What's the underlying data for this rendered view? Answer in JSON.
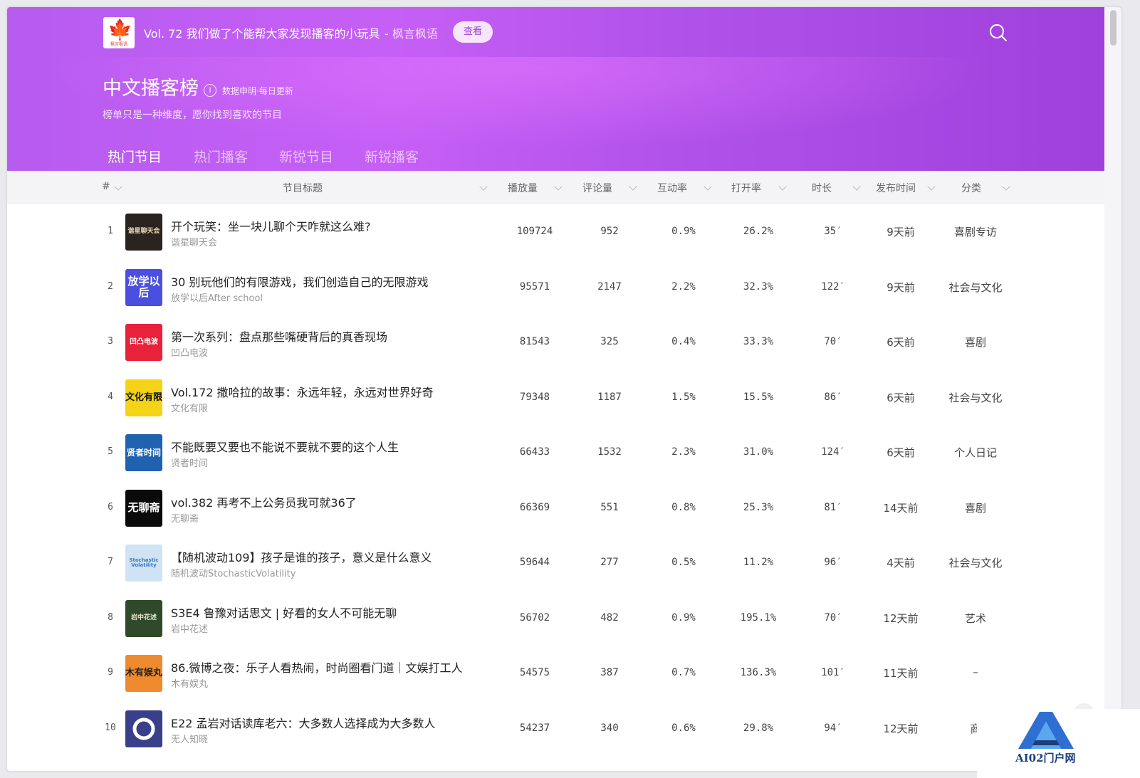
{
  "topbar": {
    "logo_text": "枫言枫语",
    "episode_title": "Vol. 72 我们做了个能帮大家发现播客的小玩具",
    "podcast_name": "- 枫言枫语",
    "view_button": "查看"
  },
  "header": {
    "title": "中文播客榜",
    "info_text": "数据申明·每日更新",
    "subtitle": "榜单只是一种维度，愿你找到喜欢的节目"
  },
  "tabs": [
    {
      "label": "热门节目",
      "active": true
    },
    {
      "label": "热门播客",
      "active": false
    },
    {
      "label": "新锐节目",
      "active": false
    },
    {
      "label": "新锐播客",
      "active": false
    }
  ],
  "columns": {
    "rank": "#",
    "title": "节目标题",
    "plays": "播放量",
    "comments": "评论量",
    "engagement": "互动率",
    "open_rate": "打开率",
    "duration": "时长",
    "published": "发布时间",
    "category": "分类"
  },
  "rows": [
    {
      "rank": "1",
      "title": "开个玩笑：坐一块儿聊个天咋就这么难?",
      "show": "谐星聊天会",
      "plays": "109724",
      "comments": "952",
      "engagement": "0.9%",
      "open_rate": "26.2%",
      "duration": "35′",
      "published": "9天前",
      "category": "喜剧专访",
      "cover_text": "谐星聊天会"
    },
    {
      "rank": "2",
      "title": "30 别玩他们的有限游戏，我们创造自己的无限游戏",
      "show": "放学以后After school",
      "plays": "95571",
      "comments": "2147",
      "engagement": "2.2%",
      "open_rate": "32.3%",
      "duration": "122′",
      "published": "9天前",
      "category": "社会与文化",
      "cover_text": "放学以后"
    },
    {
      "rank": "3",
      "title": "第一次系列：盘点那些嘴硬背后的真香现场",
      "show": "凹凸电波",
      "plays": "81543",
      "comments": "325",
      "engagement": "0.4%",
      "open_rate": "33.3%",
      "duration": "70′",
      "published": "6天前",
      "category": "喜剧",
      "cover_text": "凹凸电波"
    },
    {
      "rank": "4",
      "title": "Vol.172 撒哈拉的故事：永远年轻，永远对世界好奇",
      "show": "文化有限",
      "plays": "79348",
      "comments": "1187",
      "engagement": "1.5%",
      "open_rate": "15.5%",
      "duration": "86′",
      "published": "6天前",
      "category": "社会与文化",
      "cover_text": "文化有限"
    },
    {
      "rank": "5",
      "title": "不能既要又要也不能说不要就不要的这个人生",
      "show": "贤者时间",
      "plays": "66433",
      "comments": "1532",
      "engagement": "2.3%",
      "open_rate": "31.0%",
      "duration": "124′",
      "published": "6天前",
      "category": "个人日记",
      "cover_text": "贤者时间"
    },
    {
      "rank": "6",
      "title": "vol.382 再考不上公务员我可就36了",
      "show": "无聊斋",
      "plays": "66369",
      "comments": "551",
      "engagement": "0.8%",
      "open_rate": "25.3%",
      "duration": "81′",
      "published": "14天前",
      "category": "喜剧",
      "cover_text": "无聊斋"
    },
    {
      "rank": "7",
      "title": "【随机波动109】孩子是谁的孩子，意义是什么意义",
      "show": "随机波动StochasticVolatility",
      "plays": "59644",
      "comments": "277",
      "engagement": "0.5%",
      "open_rate": "11.2%",
      "duration": "96′",
      "published": "4天前",
      "category": "社会与文化",
      "cover_text": "Stochastic Volatility"
    },
    {
      "rank": "8",
      "title": "S3E4 鲁豫对话思文 | 好看的女人不可能无聊",
      "show": "岩中花述",
      "plays": "56702",
      "comments": "482",
      "engagement": "0.9%",
      "open_rate": "195.1%",
      "duration": "70′",
      "published": "12天前",
      "category": "艺术",
      "cover_text": "岩中花述"
    },
    {
      "rank": "9",
      "title": "86.微博之夜：乐子人看热闹，时尚圈看门道｜文娱打工人",
      "show": "木有娱丸",
      "plays": "54575",
      "comments": "387",
      "engagement": "0.7%",
      "open_rate": "136.3%",
      "duration": "101′",
      "published": "11天前",
      "category": "–",
      "cover_text": "木有娱丸"
    },
    {
      "rank": "10",
      "title": "E22 孟岩对话读库老六：大多数人选择成为大多数人",
      "show": "无人知晓",
      "plays": "54237",
      "comments": "340",
      "engagement": "0.6%",
      "open_rate": "29.8%",
      "duration": "94′",
      "published": "12天前",
      "category": "商",
      "cover_text": ""
    }
  ],
  "watermark": "AI02门户网",
  "icons": {
    "search": "search-icon",
    "info": "info-icon",
    "sort": "chevron-down-icon",
    "scroll_top": "arrow-up-icon"
  },
  "colors": {
    "hero_start": "#b75cf0",
    "hero_end": "#9f3fdc",
    "accent": "#9a3ed6"
  }
}
